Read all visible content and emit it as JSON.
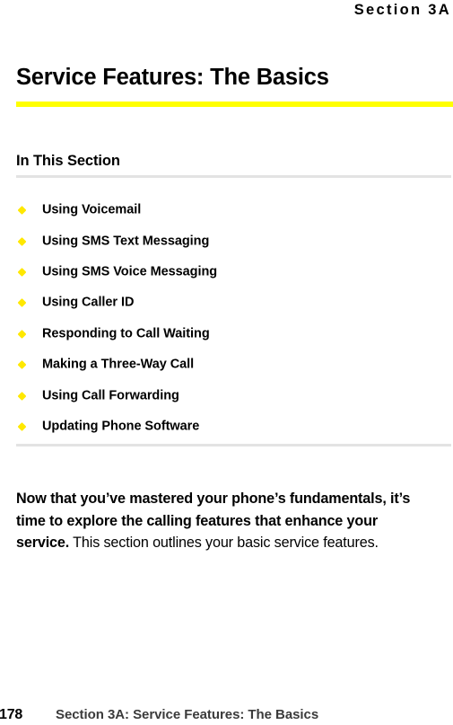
{
  "document": {
    "running_head": "Section 3A",
    "chapter_title": "Service Features: The Basics",
    "accent_color": "#ffff00",
    "rule_color": "#e3e3e3",
    "bullet_color": "#ffe800"
  },
  "in_this_section": {
    "heading": "In This Section",
    "items": [
      {
        "bullet": "diamond-bullet-icon",
        "label": "Using Voicemail"
      },
      {
        "bullet": "diamond-bullet-icon",
        "label": "Using SMS Text Messaging"
      },
      {
        "bullet": "diamond-bullet-icon",
        "label": "Using SMS Voice Messaging"
      },
      {
        "bullet": "diamond-bullet-icon",
        "label": "Using Caller ID"
      },
      {
        "bullet": "diamond-bullet-icon",
        "label": "Responding to Call Waiting"
      },
      {
        "bullet": "diamond-bullet-icon",
        "label": "Making a Three-Way Call"
      },
      {
        "bullet": "diamond-bullet-icon",
        "label": "Using Call Forwarding"
      },
      {
        "bullet": "diamond-bullet-icon",
        "label": "Updating Phone Software"
      }
    ]
  },
  "intro": {
    "lead": "Now that you’ve mastered your phone’s fundamentals, it’s time to explore the calling features that enhance your service.",
    "rest": " This section outlines your basic service features."
  },
  "footer": {
    "page_number": "178",
    "section_label": "Section 3A: Service Features: The Basics"
  }
}
